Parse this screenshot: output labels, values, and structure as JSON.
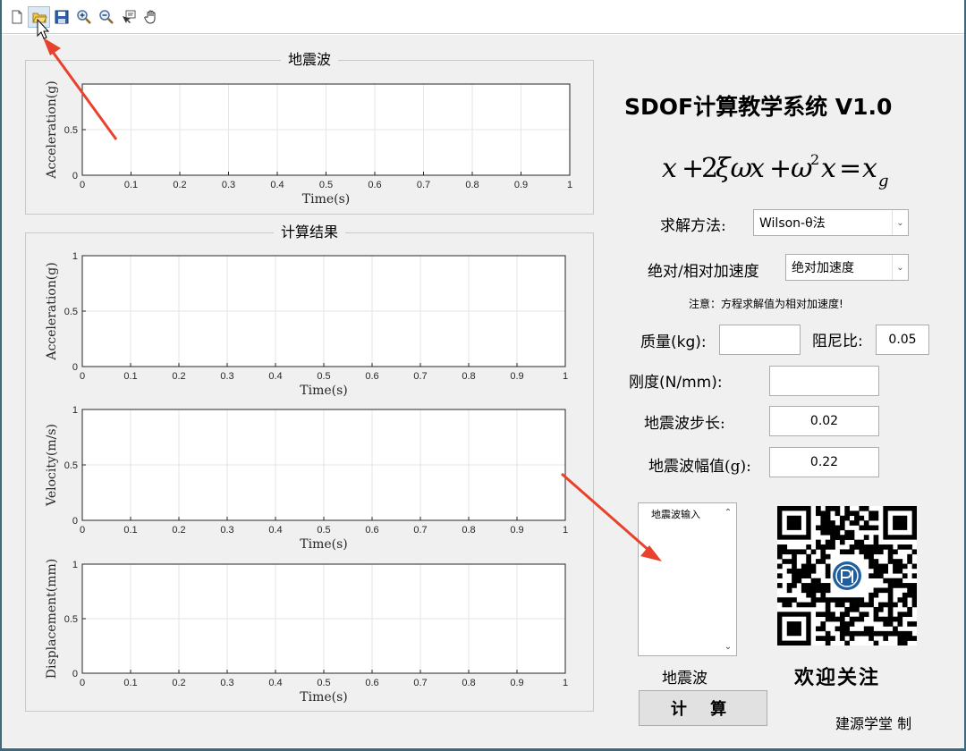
{
  "toolbar": {
    "buttons": [
      {
        "icon": "new-file-icon"
      },
      {
        "icon": "open-folder-icon"
      },
      {
        "icon": "save-icon"
      },
      {
        "icon": "zoom-in-icon"
      },
      {
        "icon": "zoom-out-icon"
      },
      {
        "icon": "data-cursor-icon"
      },
      {
        "icon": "pan-hand-icon"
      }
    ]
  },
  "panels": {
    "wave_title": "地震波",
    "result_title": "计算结果"
  },
  "app": {
    "title": "SDOF计算教学系统 V1.0"
  },
  "form": {
    "method_label": "求解方法:",
    "method_value": "Wilson-θ法",
    "accel_type_label": "绝对/相对加速度",
    "accel_type_value": "绝对加速度",
    "note": "注意：方程求解值为相对加速度!",
    "mass_label": "质量(kg):",
    "mass_value": "",
    "damping_label": "阻尼比:",
    "damping_value": "0.05",
    "stiffness_label": "刚度(N/mm):",
    "stiffness_value": "",
    "step_label": "地震波步长:",
    "step_value": "0.02",
    "amp_label": "地震波幅值(g):",
    "amp_value": "0.22"
  },
  "listbox": {
    "items": [
      "地震波输入"
    ],
    "caption": "地震波"
  },
  "calc_button": "计 算",
  "follow_text": "欢迎关注",
  "credit_text": "建源学堂 制",
  "colors": {
    "frame": "#3c6a7a",
    "background": "#f0f0f0",
    "annotation_arrow": "#e8412c"
  },
  "chart_data": [
    {
      "type": "line",
      "title": "",
      "xlabel": "Time(s)",
      "ylabel": "Acceleration(g)",
      "xlim": [
        0,
        1
      ],
      "ylim": [
        0,
        1
      ],
      "xticks": [
        "0",
        "0.1",
        "0.2",
        "0.3",
        "0.4",
        "0.5",
        "0.6",
        "0.7",
        "0.8",
        "0.9",
        "1"
      ],
      "yticks": [
        "0",
        "0.5"
      ],
      "grid": true,
      "series": []
    },
    {
      "type": "line",
      "title": "",
      "xlabel": "Time(s)",
      "ylabel": "Acceleration(g)",
      "xlim": [
        0,
        1
      ],
      "ylim": [
        0,
        1
      ],
      "xticks": [
        "0",
        "0.1",
        "0.2",
        "0.3",
        "0.4",
        "0.5",
        "0.6",
        "0.7",
        "0.8",
        "0.9",
        "1"
      ],
      "yticks": [
        "0",
        "0.5",
        "1"
      ],
      "grid": true,
      "series": []
    },
    {
      "type": "line",
      "title": "",
      "xlabel": "Time(s)",
      "ylabel": "Velocity(m/s)",
      "xlim": [
        0,
        1
      ],
      "ylim": [
        0,
        1
      ],
      "xticks": [
        "0",
        "0.1",
        "0.2",
        "0.3",
        "0.4",
        "0.5",
        "0.6",
        "0.7",
        "0.8",
        "0.9",
        "1"
      ],
      "yticks": [
        "0",
        "0.5",
        "1"
      ],
      "grid": true,
      "series": []
    },
    {
      "type": "line",
      "title": "",
      "xlabel": "Time(s)",
      "ylabel": "Displacement(mm)",
      "xlim": [
        0,
        1
      ],
      "ylim": [
        0,
        1
      ],
      "xticks": [
        "0",
        "0.1",
        "0.2",
        "0.3",
        "0.4",
        "0.5",
        "0.6",
        "0.7",
        "0.8",
        "0.9",
        "1"
      ],
      "yticks": [
        "0",
        "0.5",
        "1"
      ],
      "grid": true,
      "series": []
    }
  ]
}
